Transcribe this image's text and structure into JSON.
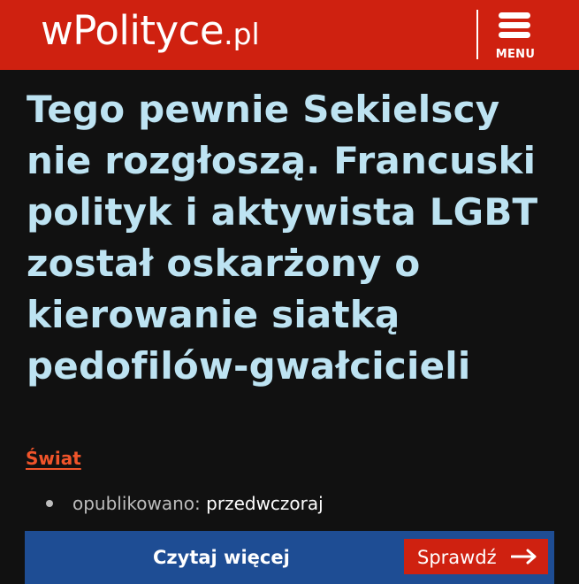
{
  "header": {
    "logo_main": "wPolityce",
    "logo_tld": ".pl",
    "menu_label": "MENU",
    "background": "#cf2110"
  },
  "article": {
    "title": "Tego pewnie Sekielscy nie rozgłoszą. Francuski polityk i aktywista LGBT został oskarżony o kierowanie siatką pedofilów-gwałcicieli",
    "category": "Świat",
    "published_label": "opublikowano:",
    "published_value": "przedwczoraj"
  },
  "cta_bar": {
    "text": "Czytaj więcej",
    "button_label": "Sprawdź",
    "button_icon": "arrow-right-icon"
  },
  "colors": {
    "background": "#111111",
    "title": "#bde3f2",
    "category": "#f0542a",
    "cta_bar": "#1e4d94",
    "button": "#cf2110"
  }
}
